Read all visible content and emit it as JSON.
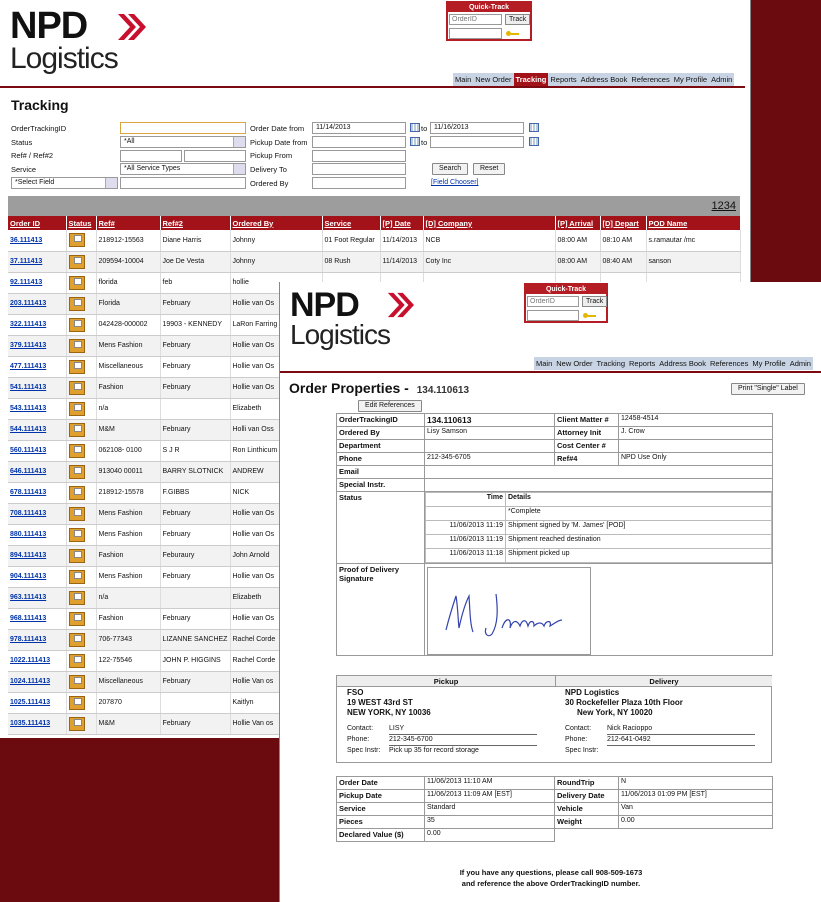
{
  "brand": {
    "name_top": "NPD",
    "name_bottom": "Logistics"
  },
  "quick_track": {
    "title": "Quick-Track",
    "placeholder": "OrderID",
    "button": "Track"
  },
  "nav": [
    "Main",
    "New Order",
    "Tracking",
    "Reports",
    "Address Book",
    "References",
    "My Profile",
    "Admin"
  ],
  "tracking": {
    "title": "Tracking",
    "labels": {
      "order_tracking_id": "OrderTrackingID",
      "status": "Status",
      "ref": "Ref# / Ref#2",
      "service": "Service",
      "order_date_from": "Order Date from",
      "pickup_date_from": "Pickup Date from",
      "pickup_from": "Pickup From",
      "delivery_to": "Delivery To",
      "ordered_by": "Ordered By",
      "to1": "to",
      "to2": "to"
    },
    "values": {
      "status": "*All",
      "service": "*All Service Types",
      "select_field": "*Select Field",
      "order_date_from": "11/14/2013",
      "order_date_to": "11/16/2013"
    },
    "search": "Search",
    "reset": "Reset",
    "field_chooser": "[Field Chooser]",
    "pages": "1234"
  },
  "grid": {
    "columns": [
      "Order ID",
      "Status",
      "Ref#",
      "Ref#2",
      "Ordered By",
      "Service",
      "[P] Date",
      "[D] Company",
      "[P] Arrival",
      "[D] Depart",
      "POD Name"
    ],
    "rows": [
      [
        "36.111413",
        "218912-15563",
        "Diane Harris",
        "Johnny",
        "01 Foot Regular",
        "11/14/2013",
        "NCB",
        "08:00 AM",
        "08:10 AM",
        "s.ramautar /mc"
      ],
      [
        "37.111413",
        "209594-10004",
        "Joe De Vesta",
        "Johnny",
        "08 Rush",
        "11/14/2013",
        "Coty Inc",
        "08:00 AM",
        "08:40 AM",
        "sanson"
      ],
      [
        "92.111413",
        "florida",
        "feb",
        "hollie",
        "",
        "",
        "",
        "",
        "",
        ""
      ],
      [
        "203.111413",
        "Florida",
        "February",
        "Hollie van Os",
        "",
        "",
        "",
        "",
        "",
        ""
      ],
      [
        "322.111413",
        "042428-000002",
        "19903 - KENNEDY",
        "LaRon Farring",
        "",
        "",
        "",
        "",
        "",
        ""
      ],
      [
        "379.111413",
        "Mens Fashion",
        "February",
        "Hollie van Os",
        "",
        "",
        "",
        "",
        "",
        ""
      ],
      [
        "477.111413",
        "Miscellaneous",
        "February",
        "Hollie van Os",
        "",
        "",
        "",
        "",
        "",
        ""
      ],
      [
        "541.111413",
        "Fashion",
        "February",
        "Hollie van Os",
        "",
        "",
        "",
        "",
        "",
        ""
      ],
      [
        "543.111413",
        "n/a",
        "",
        "Elizabeth",
        "",
        "",
        "",
        "",
        "",
        ""
      ],
      [
        "544.111413",
        "M&M",
        "February",
        "Holli van Oss",
        "",
        "",
        "",
        "",
        "",
        ""
      ],
      [
        "560.111413",
        "062108- 0100",
        "S J R",
        "Ron Linthicum",
        "",
        "",
        "",
        "",
        "",
        ""
      ],
      [
        "646.111413",
        "913040 00011",
        "BARRY SLOTNICK",
        "ANDREW",
        "",
        "",
        "",
        "",
        "",
        ""
      ],
      [
        "678.111413",
        "218912-15578",
        "F.GIBBS",
        "NICK",
        "",
        "",
        "",
        "",
        "",
        ""
      ],
      [
        "708.111413",
        "Mens Fashion",
        "February",
        "Hollie van Os",
        "",
        "",
        "",
        "",
        "",
        ""
      ],
      [
        "880.111413",
        "Mens Fashion",
        "February",
        "Hollie van Os",
        "",
        "",
        "",
        "",
        "",
        ""
      ],
      [
        "894.111413",
        "Fashion",
        "Feburaury",
        "John Arnold",
        "",
        "",
        "",
        "",
        "",
        ""
      ],
      [
        "904.111413",
        "Mens Fashion",
        "February",
        "Hollie van Os",
        "",
        "",
        "",
        "",
        "",
        ""
      ],
      [
        "963.111413",
        "n/a",
        "",
        "Elizabeth",
        "",
        "",
        "",
        "",
        "",
        ""
      ],
      [
        "968.111413",
        "Fashion",
        "February",
        "Hollie van Os",
        "",
        "",
        "",
        "",
        "",
        ""
      ],
      [
        "978.111413",
        "706-77343",
        "LIZANNE SANCHEZ",
        "Rachel Corde",
        "",
        "",
        "",
        "",
        "",
        ""
      ],
      [
        "1022.111413",
        "122-75546",
        "JOHN P. HIGGINS",
        "Rachel Corde",
        "",
        "",
        "",
        "",
        "",
        ""
      ],
      [
        "1024.111413",
        "Miscellaneous",
        "February",
        "Hollie Van os",
        "",
        "",
        "",
        "",
        "",
        ""
      ],
      [
        "1025.111413",
        "207870",
        "",
        "Kaitlyn",
        "",
        "",
        "",
        "",
        "",
        ""
      ],
      [
        "1035.111413",
        "M&M",
        "February",
        "Hollie Van os",
        "",
        "",
        "",
        "",
        "",
        ""
      ]
    ]
  },
  "order": {
    "title": "Order Properties -",
    "id": "134.110613",
    "print_button": "Print \"Single\" Label",
    "edit_refs": "Edit References",
    "fields": {
      "order_tracking_id_k": "OrderTrackingID",
      "order_tracking_id": "134.110613",
      "client_matter_k": "Client Matter #",
      "client_matter": "12458-4514",
      "ordered_by_k": "Ordered By",
      "ordered_by": "Lisy Samson",
      "attorney_k": "Attorney Init",
      "attorney": "J. Crow",
      "department_k": "Department",
      "cost_center_k": "Cost Center #",
      "phone_k": "Phone",
      "phone": "212-345-6705",
      "ref4_k": "Ref#4",
      "ref4": "NPD Use Only",
      "email_k": "Email",
      "special_k": "Special Instr.",
      "status_k": "Status",
      "pod_k": "Proof of Delivery Signature"
    },
    "status_head": {
      "time": "Time",
      "details": "Details"
    },
    "status_rows": [
      {
        "time": "",
        "details": "*Complete"
      },
      {
        "time": "11/06/2013 11:19",
        "details": "Shipment signed by 'M. James' [POD]"
      },
      {
        "time": "11/06/2013 11:19",
        "details": "Shipment reached destination"
      },
      {
        "time": "11/06/2013 11:18",
        "details": "Shipment picked up"
      }
    ],
    "pickup": {
      "head": "Pickup",
      "name": "FSO",
      "addr1": "19 WEST 43rd ST",
      "addr2": "NEW YORK, NY 10036",
      "contact_k": "Contact:",
      "contact": "LISY",
      "phone_k": "Phone:",
      "phone": "212-345-6700",
      "spec_k": "Spec Instr:",
      "spec": "Pick up 35 for record storage"
    },
    "delivery": {
      "head": "Delivery",
      "name": "NPD Logistics",
      "addr1": "30 Rockefeller Plaza 10th Floor",
      "addr2": "New York, NY 10020",
      "contact_k": "Contact:",
      "contact": "Nick Racioppo",
      "phone_k": "Phone:",
      "phone": "212-641-0492",
      "spec_k": "Spec Instr:",
      "spec": ""
    },
    "summary": {
      "order_date_k": "Order Date",
      "order_date": "11/06/2013 11:10 AM",
      "roundtrip_k": "RoundTrip",
      "roundtrip": "N",
      "pickup_date_k": "Pickup Date",
      "pickup_date": "11/06/2013 11:09 AM [EST]",
      "delivery_date_k": "Delivery Date",
      "delivery_date": "11/06/2013 01:09 PM [EST]",
      "service_k": "Service",
      "service": "Standard",
      "vehicle_k": "Vehicle",
      "vehicle": "Van",
      "pieces_k": "Pieces",
      "pieces": "35",
      "weight_k": "Weight",
      "weight": "0.00",
      "declared_k": "Declared Value ($)",
      "declared": "0.00"
    },
    "footer1": "If you have any questions, please call 908-509-1673",
    "footer2": "and reference the above OrderTrackingID number."
  },
  "colors": {
    "brand_red": "#a31219",
    "dark_red_bg": "#6b0b10",
    "nav_blue": "#c8d4e3"
  }
}
